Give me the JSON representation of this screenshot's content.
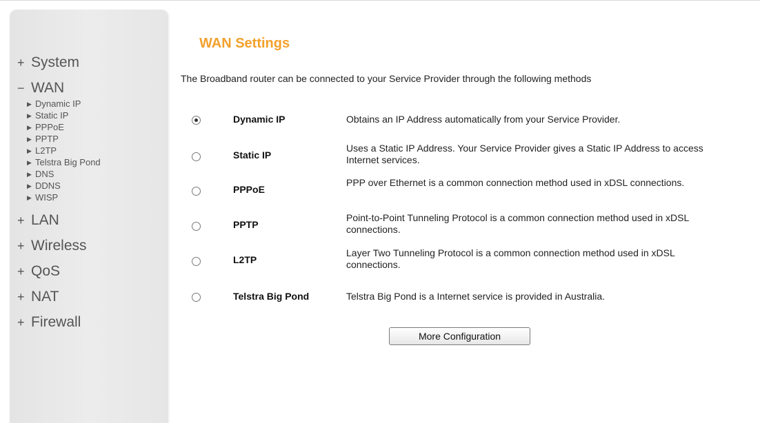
{
  "sidebar": {
    "groups": [
      {
        "sign": "+",
        "label": "System"
      },
      {
        "sign": "−",
        "label": "WAN",
        "items": [
          "Dynamic IP",
          "Static IP",
          "PPPoE",
          "PPTP",
          "L2TP",
          "Telstra Big Pond",
          "DNS",
          "DDNS",
          "WISP"
        ]
      },
      {
        "sign": "+",
        "label": "LAN"
      },
      {
        "sign": "+",
        "label": "Wireless"
      },
      {
        "sign": "+",
        "label": "QoS"
      },
      {
        "sign": "+",
        "label": "NAT"
      },
      {
        "sign": "+",
        "label": "Firewall"
      }
    ]
  },
  "main": {
    "title": "WAN Settings",
    "intro": "The Broadband router can be connected to your Service Provider through the following methods",
    "options": [
      {
        "label": "Dynamic IP",
        "desc": "Obtains an IP Address automatically from your Service Provider.",
        "selected": true
      },
      {
        "label": "Static IP",
        "desc": "Uses a Static IP Address. Your Service Provider gives a Static IP Address to access Internet services.",
        "selected": false
      },
      {
        "label": "PPPoE",
        "desc": "PPP over Ethernet is a common connection method used in xDSL connections.",
        "selected": false
      },
      {
        "label": "PPTP",
        "desc": "Point-to-Point Tunneling Protocol is a common connection method used in xDSL connections.",
        "selected": false
      },
      {
        "label": "L2TP",
        "desc": "Layer Two Tunneling Protocol is a common connection method used in xDSL connections.",
        "selected": false
      },
      {
        "label": "Telstra Big Pond",
        "desc": "Telstra Big Pond is a Internet service is provided in Australia.",
        "selected": false
      }
    ],
    "button_label": "More Configuration"
  },
  "colors": {
    "title": "#f3a02b",
    "sidebar_bg": "#e8e8e8",
    "menu_text": "#555555"
  }
}
